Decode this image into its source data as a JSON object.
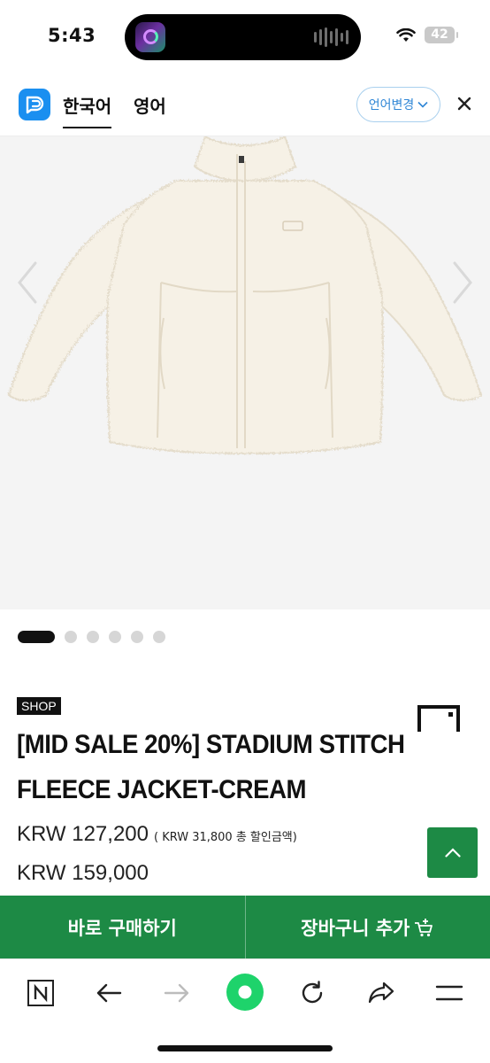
{
  "status_bar": {
    "time": "5:43",
    "battery": "42"
  },
  "language_bar": {
    "tabs": [
      {
        "label": "한국어",
        "active": true
      },
      {
        "label": "영어",
        "active": false
      }
    ],
    "change_button": "언어변경"
  },
  "gallery": {
    "image_alt": "cream sherpa fleece zip-up jacket",
    "slide_count": 6,
    "active_slide": 1
  },
  "product": {
    "badge": "SHOP",
    "title": "[MID SALE 20%] STADIUM STITCH FLEECE JACKET-CREAM",
    "sale_price": "KRW 127,200",
    "discount_note": "( KRW 31,800 총 할인금액)",
    "original_price": "KRW 159,000"
  },
  "purchase_bar": {
    "buy_now": "바로 구매하기",
    "add_to_cart": "장바구니 추가"
  },
  "colors": {
    "accent_green": "#1d8a45",
    "link_blue": "#2f86d6",
    "logo_blue": "#1a8ff0"
  },
  "toolbar_icons": [
    "naver-n-icon",
    "back-arrow-icon",
    "forward-arrow-icon",
    "green-home-icon",
    "reload-icon",
    "share-icon",
    "menu-icon"
  ]
}
